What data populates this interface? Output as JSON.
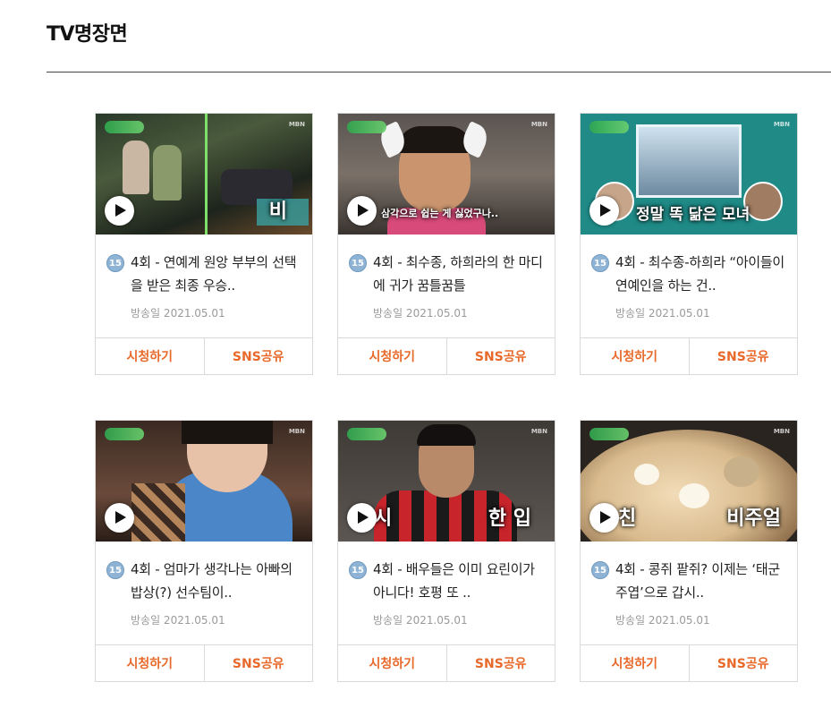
{
  "section": {
    "title": "TV명장면"
  },
  "cards": [
    {
      "rating": "15",
      "title": "4회 - 연예계 원앙 부부의 선택을 받은 최종 우승..",
      "date": "방송일 2021.05.01",
      "watch_label": "시청하기",
      "share_label": "SNS공유",
      "overlay": "비"
    },
    {
      "rating": "15",
      "title": "4회 - 최수종, 하희라의 한 마디에 귀가 꿈틀꿈틀",
      "date": "방송일 2021.05.01",
      "watch_label": "시청하기",
      "share_label": "SNS공유",
      "overlay": "삼각으로 쉽는 게 싫었구나.."
    },
    {
      "rating": "15",
      "title": "4회 - 최수종-하희라 “아이들이 연예인을 하는 건..",
      "date": "방송일 2021.05.01",
      "watch_label": "시청하기",
      "share_label": "SNS공유",
      "overlay": "정말 똑 닮은 모녀"
    },
    {
      "rating": "15",
      "title": "4회 - 엄마가 생각나는 아빠의 밥상(?) 선수팀이..",
      "date": "방송일 2021.05.01",
      "watch_label": "시청하기",
      "share_label": "SNS공유"
    },
    {
      "rating": "15",
      "title": "4회 - 배우들은 이미 요린이가 아니다! 호평 또 ..",
      "date": "방송일 2021.05.01",
      "watch_label": "시청하기",
      "share_label": "SNS공유",
      "overlay_left": "시",
      "overlay_right": "한 입"
    },
    {
      "rating": "15",
      "title": "4회 - 콩쥐 팥쥐? 이제는 ‘태군 주엽’으로 갑시..",
      "date": "방송일 2021.05.01",
      "watch_label": "시청하기",
      "share_label": "SNS공유",
      "overlay_left": "친",
      "overlay_right": "비주얼"
    }
  ],
  "thumbnail_brand": "MBN",
  "colors": {
    "accent": "#e8692a",
    "rating_badge": "#8fb3d4",
    "date_text": "#9a9a9a",
    "border": "#d9d9d9"
  }
}
